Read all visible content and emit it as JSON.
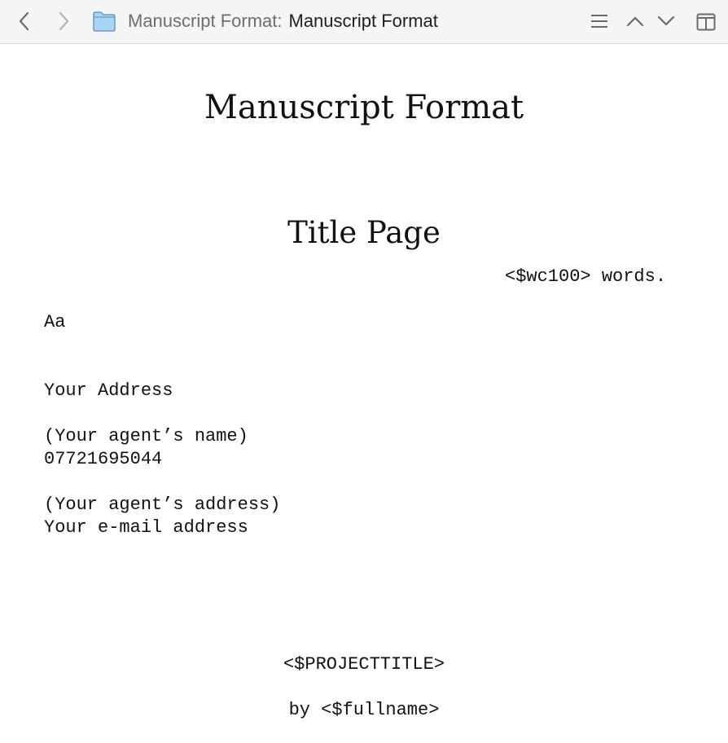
{
  "toolbar": {
    "breadcrumb_parent": "Manuscript Format:",
    "breadcrumb_current": "Manuscript Format",
    "icons": {
      "back": "chevron-left-icon",
      "forward": "chevron-right-icon",
      "folder": "folder-icon",
      "list": "list-icon",
      "up": "chevron-up-icon",
      "down": "chevron-down-icon",
      "split": "split-view-icon"
    },
    "folder_color": "#a7d4f5"
  },
  "document": {
    "title": "Manuscript Format",
    "section_heading": "Title Page",
    "author": {
      "name": "Aa",
      "address": "Your Address",
      "phone": "07721695044",
      "email": "Your e-mail address"
    },
    "word_count": "<$wc100> words.",
    "agent": {
      "name": "(Your agent’s name)",
      "address": "(Your agent’s address)"
    },
    "project_title": "<$PROJECTTITLE>",
    "byline": "by <$fullname>"
  }
}
